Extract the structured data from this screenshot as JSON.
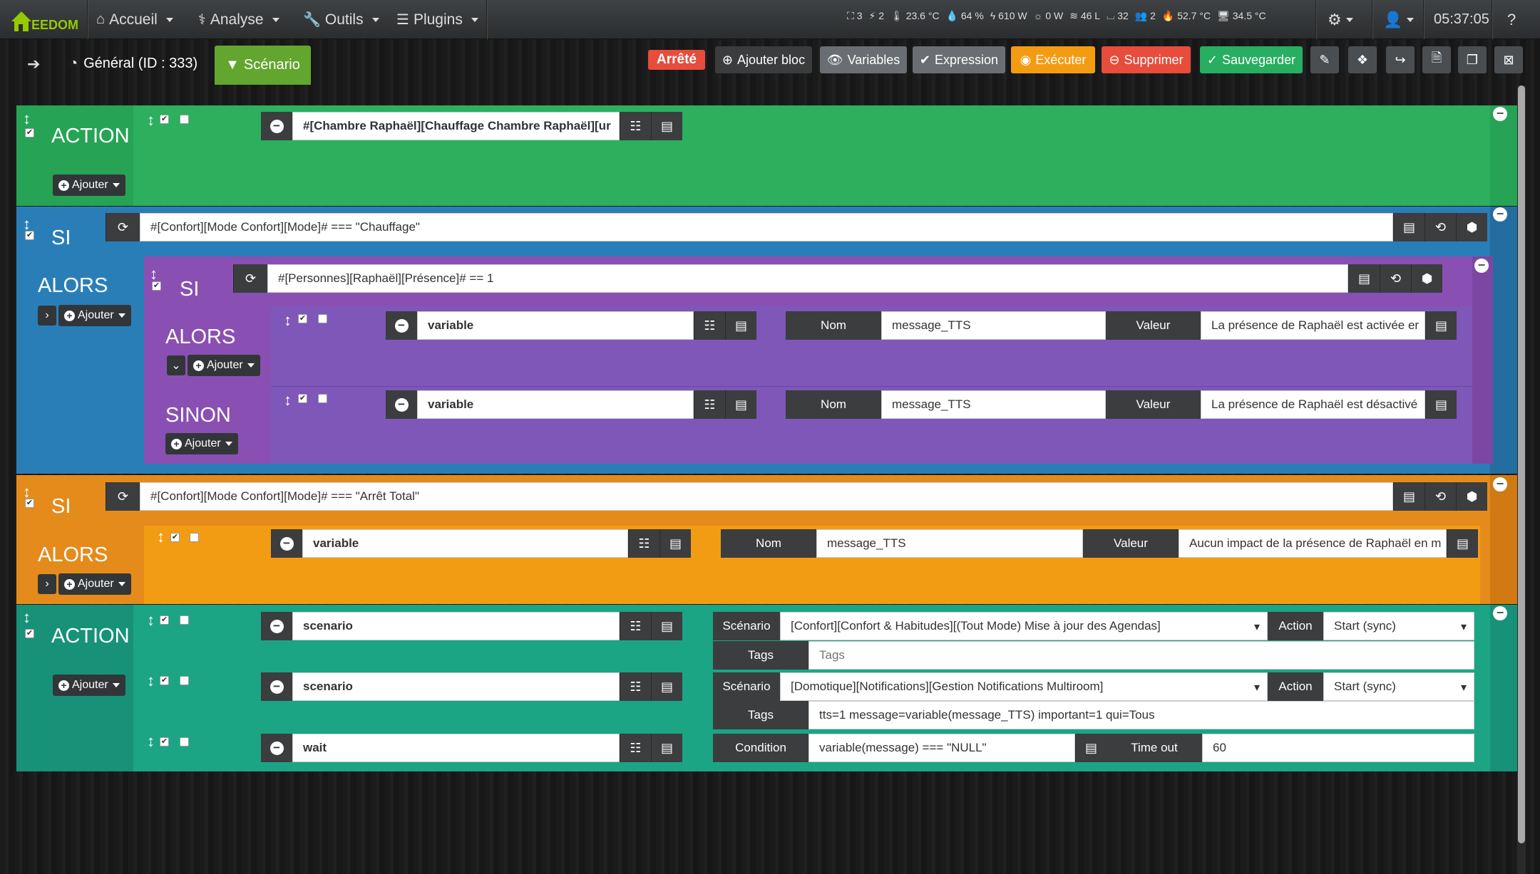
{
  "navbar": {
    "logo_text": "EEDOM",
    "menus": [
      {
        "label": "Accueil",
        "icon": "home-icon"
      },
      {
        "label": "Analyse",
        "icon": "stethoscope-icon"
      },
      {
        "label": "Outils",
        "icon": "wrench-icon"
      },
      {
        "label": "Plugins",
        "icon": "list-icon"
      }
    ],
    "status": [
      "3",
      "2",
      "23.6 °C",
      "64 %",
      "610 W",
      "0 W",
      "46 L",
      "32",
      "2",
      "52.7 °C",
      "34.5 °C"
    ],
    "clock": "05:37:05"
  },
  "subbar": {
    "general_label": "Général (ID : 333)",
    "scenario_tab": "Scénario",
    "state_badge": "Arrêté",
    "add_block": "Ajouter bloc",
    "variables": "Variables",
    "expression": "Expression",
    "execute": "Exécuter",
    "delete": "Supprimer",
    "save": "Sauvegarder"
  },
  "labels": {
    "action": "ACTION",
    "si": "SI",
    "alors": "ALORS",
    "sinon": "SINON",
    "ajouter": "Ajouter",
    "nom": "Nom",
    "valeur": "Valeur",
    "scenario": "Scénario",
    "action_lbl": "Action",
    "tags": "Tags",
    "condition": "Condition",
    "timeout": "Time out"
  },
  "block1": {
    "cmd": "#[Chambre Raphaël][Chauffage Chambre Raphaël][ur"
  },
  "block2": {
    "condition": "#[Confort][Mode Confort][Mode]# === \"Chauffage\"",
    "inner_condition": "#[Personnes][Raphaël][Présence]# == 1",
    "then_var": "variable",
    "then_name": "message_TTS",
    "then_value": "La présence de Raphaël est activée er",
    "else_var": "variable",
    "else_name": "message_TTS",
    "else_value": "La présence de Raphaël est désactivé"
  },
  "block3": {
    "condition": "#[Confort][Mode Confort][Mode]# === \"Arrêt Total\"",
    "var": "variable",
    "name": "message_TTS",
    "value": "Aucun impact de la présence de Raphaël en m"
  },
  "block4": {
    "rows": [
      {
        "cmd": "scenario",
        "scenario": "[Confort][Confort & Habitudes][(Tout Mode) Mise à jour des Agendas]",
        "action": "Start (sync)",
        "tags": "",
        "tags_placeholder": "Tags"
      },
      {
        "cmd": "scenario",
        "scenario": "[Domotique][Notifications][Gestion Notifications Multiroom]",
        "action": "Start (sync)",
        "tags": "tts=1 message=variable(message_TTS) important=1 qui=Tous"
      },
      {
        "cmd": "wait",
        "condition": "variable(message) === \"NULL\"",
        "timeout": "60"
      }
    ]
  },
  "colors": {
    "action_green": "#2ba462",
    "si_blue": "#2980b9",
    "si_purple": "#8e44ad",
    "si_orange": "#e67e22",
    "action_teal": "#16a085"
  }
}
